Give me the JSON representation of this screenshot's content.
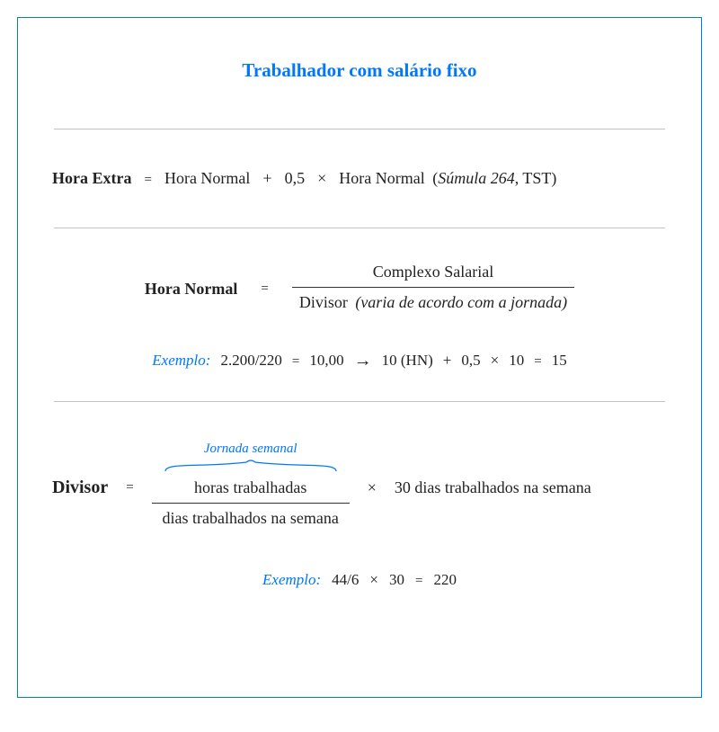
{
  "title": "Trabalhador com salário fixo",
  "section1": {
    "lhs": "Hora Extra",
    "eq": "=",
    "term1": "Hora Normal",
    "plus": "+",
    "factor": "0,5",
    "times": "×",
    "term2": "Hora Normal",
    "note_open": "(",
    "note_ital": "Súmula 264",
    "note_rest": ", TST)"
  },
  "section2": {
    "lhs": "Hora Normal",
    "eq": "=",
    "numerator": "Complexo Salarial",
    "denominator_plain": "Divisor",
    "denominator_ital": "(varia de acordo com a jornada)",
    "example_label": "Exemplo:",
    "ex_a": "2.200/220",
    "ex_eq1": "=",
    "ex_b": "10,00",
    "ex_c": "10 (HN)",
    "ex_plus": "+",
    "ex_d": "0,5",
    "ex_times": "×",
    "ex_e": "10",
    "ex_eq2": "=",
    "ex_f": "15"
  },
  "section3": {
    "lhs": "Divisor",
    "eq": "=",
    "brace_label": "Jornada semanal",
    "numerator": "horas trabalhadas",
    "denominator": "dias trabalhados na semana",
    "times": "×",
    "rhs_rest": "30 dias trabalhados na semana",
    "example_label": "Exemplo:",
    "ex_a": "44/6",
    "ex_times": "×",
    "ex_b": "30",
    "ex_eq": "=",
    "ex_c": "220"
  }
}
